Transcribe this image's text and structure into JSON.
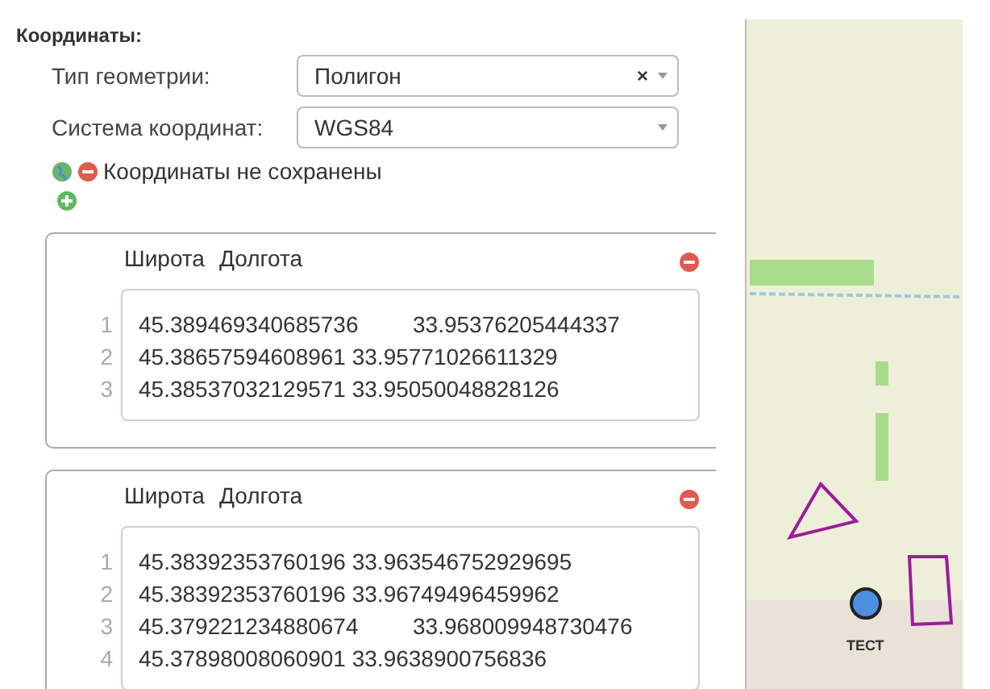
{
  "section_title": "Координаты:",
  "fields": [
    {
      "label": "Тип геометрии:",
      "value": "Полигон",
      "clear_icon": "×"
    },
    {
      "label": "Система координат:",
      "value": "WGS84"
    }
  ],
  "status": {
    "text": "Координаты не сохранены"
  },
  "coordinate_sets": [
    {
      "headers": [
        "Широта",
        "Долгота"
      ],
      "lines": [
        "45.389469340685736\t33.95376205444337",
        "45.38657594608961 33.95771026611329",
        "45.38537032129571 33.95050048828126"
      ],
      "line_numbers": [
        "1",
        "2",
        "3"
      ]
    },
    {
      "headers": [
        "Широта",
        "Долгота"
      ],
      "lines": [
        "45.38392353760196 33.963546752929695",
        "45.38392353760196 33.96749496459962",
        "45.379221234880674\t33.968009948730476",
        "45.37898008060901 33.9638900756836"
      ],
      "line_numbers": [
        "1",
        "2",
        "3",
        "4"
      ]
    }
  ],
  "map": {
    "marker_label": "ТЕСТ"
  }
}
